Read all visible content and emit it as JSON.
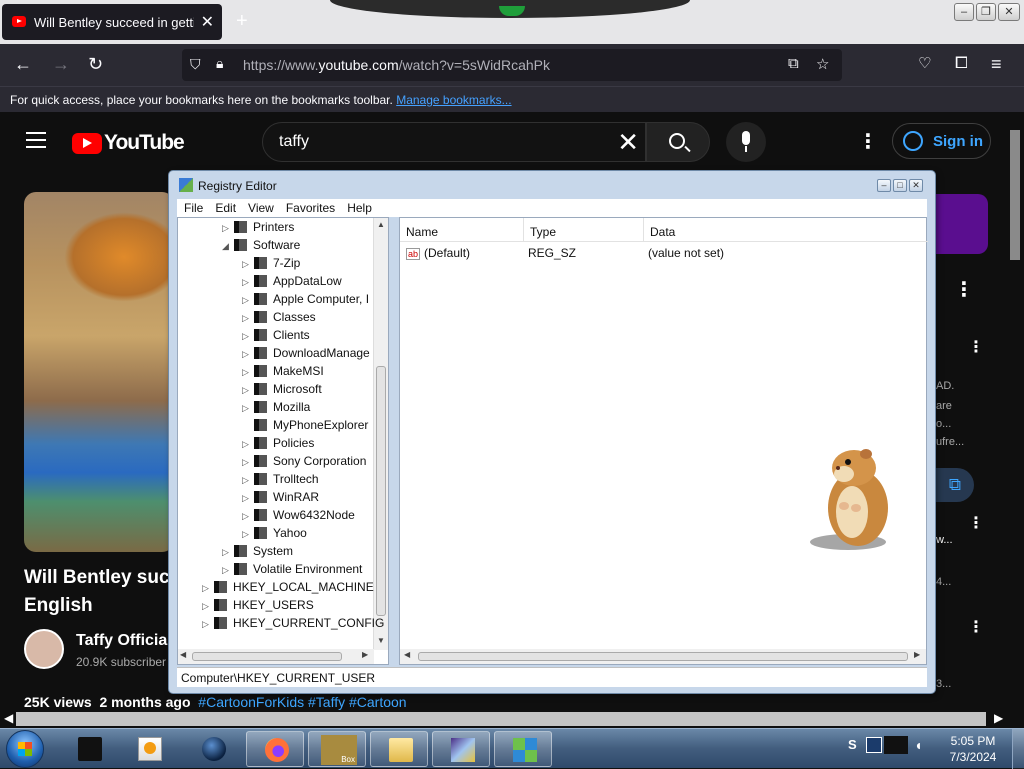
{
  "browser": {
    "tab_title": "Will Bentley succeed in getting",
    "tab_close": "✕",
    "new_tab": "+",
    "url_prefix": "https://www.",
    "url_host": "youtube.com",
    "url_path": "/watch?v=5sWidRcahPk",
    "bookmarks_text": "For quick access, place your bookmarks here on the bookmarks toolbar.",
    "bookmarks_link": "Manage bookmarks..."
  },
  "youtube": {
    "logo_text": "YouTube",
    "search_query": "taffy",
    "sign_in": "Sign in",
    "video_title_line1": "Will Bentley suc",
    "video_title_line2": "English",
    "channel_name": "Taffy Official",
    "channel_subs": "20.9K subscriber",
    "views": "25K views",
    "age": "2 months ago",
    "tags": "#CartoonForKids #Taffy #Cartoon",
    "side_texts": [
      "AD.",
      "are",
      "o...",
      "ufre...",
      "w...",
      "4...",
      "3..."
    ]
  },
  "regedit": {
    "title": "Registry Editor",
    "menu": [
      "File",
      "Edit",
      "View",
      "Favorites",
      "Help"
    ],
    "tree": [
      {
        "label": "Printers",
        "level": 2,
        "expander": "▷"
      },
      {
        "label": "Software",
        "level": 2,
        "expander": "◢"
      },
      {
        "label": "7-Zip",
        "level": 3,
        "expander": "▷"
      },
      {
        "label": "AppDataLow",
        "level": 3,
        "expander": "▷"
      },
      {
        "label": "Apple Computer, I",
        "level": 3,
        "expander": "▷"
      },
      {
        "label": "Classes",
        "level": 3,
        "expander": "▷"
      },
      {
        "label": "Clients",
        "level": 3,
        "expander": "▷"
      },
      {
        "label": "DownloadManage",
        "level": 3,
        "expander": "▷"
      },
      {
        "label": "MakeMSI",
        "level": 3,
        "expander": "▷"
      },
      {
        "label": "Microsoft",
        "level": 3,
        "expander": "▷"
      },
      {
        "label": "Mozilla",
        "level": 3,
        "expander": "▷"
      },
      {
        "label": "MyPhoneExplorer",
        "level": 3,
        "expander": ""
      },
      {
        "label": "Policies",
        "level": 3,
        "expander": "▷"
      },
      {
        "label": "Sony Corporation",
        "level": 3,
        "expander": "▷"
      },
      {
        "label": "Trolltech",
        "level": 3,
        "expander": "▷"
      },
      {
        "label": "WinRAR",
        "level": 3,
        "expander": "▷"
      },
      {
        "label": "Wow6432Node",
        "level": 3,
        "expander": "▷"
      },
      {
        "label": "Yahoo",
        "level": 3,
        "expander": "▷"
      },
      {
        "label": "System",
        "level": 2,
        "expander": "▷"
      },
      {
        "label": "Volatile Environment",
        "level": 2,
        "expander": "▷"
      },
      {
        "label": "HKEY_LOCAL_MACHINE",
        "level": 1,
        "expander": "▷"
      },
      {
        "label": "HKEY_USERS",
        "level": 1,
        "expander": "▷"
      },
      {
        "label": "HKEY_CURRENT_CONFIG",
        "level": 1,
        "expander": "▷"
      }
    ],
    "columns": [
      "Name",
      "Type",
      "Data"
    ],
    "values": [
      {
        "name": "(Default)",
        "type": "REG_SZ",
        "data": "(value not set)"
      }
    ],
    "value_icon": "ab",
    "status": "Computer\\HKEY_CURRENT_USER"
  },
  "taskbar": {
    "time": "5:05 PM",
    "date": "7/3/2024",
    "box_label": "Box"
  }
}
